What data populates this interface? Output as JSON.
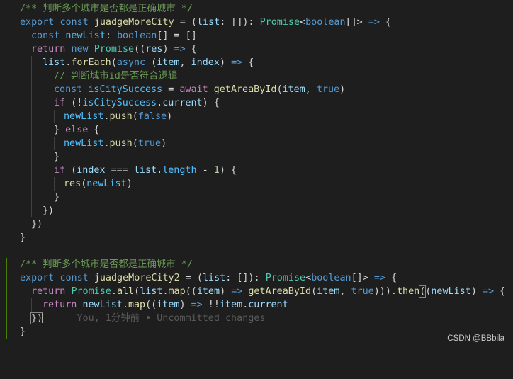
{
  "editor": {
    "block1": {
      "comment": "/** 判断多个城市是否都是正确城市 */",
      "kw_export": "export",
      "kw_const": "const",
      "fn_name": "juadgeMoreCity",
      "eq": " = (",
      "param": "list",
      "param_type": ": []): ",
      "ret_type": "Promise",
      "ret_generic_open": "<",
      "ret_generic_inner": "boolean",
      "ret_generic_close": "[]> ",
      "arrow": "=>",
      "brace_open": " {",
      "l2_const": "const",
      "l2_var": "newList",
      "l2_colon": ": ",
      "l2_type": "boolean",
      "l2_rest": "[] = []",
      "l3_return": "return",
      "l3_new": "new",
      "l3_promise": "Promise",
      "l3_open": "((",
      "l3_res": "res",
      "l3_close": ") ",
      "l3_arrow": "=>",
      "l3_brace": " {",
      "l4_list": "list",
      "l4_dot": ".",
      "l4_foreach": "forEach",
      "l4_open": "(",
      "l4_async": "async",
      "l4_paren": " (",
      "l4_item": "item",
      "l4_comma": ", ",
      "l4_index": "index",
      "l4_close": ") ",
      "l4_arrow": "=>",
      "l4_brace": " {",
      "l5_comment": "// 判断城市id是否符合逻辑",
      "l6_const": "const",
      "l6_var": "isCitySuccess",
      "l6_eq": " = ",
      "l6_await": "await",
      "l6_fn": "getAreaById",
      "l6_open": "(",
      "l6_item": "item",
      "l6_comma": ", ",
      "l6_true": "true",
      "l6_close": ")",
      "l7_if": "if",
      "l7_open": " (!",
      "l7_var": "isCitySuccess",
      "l7_dot": ".",
      "l7_prop": "current",
      "l7_close": ") {",
      "l8_var": "newList",
      "l8_dot": ".",
      "l8_fn": "push",
      "l8_open": "(",
      "l8_false": "false",
      "l8_close": ")",
      "l9_open": "} ",
      "l9_else": "else",
      "l9_close": " {",
      "l10_var": "newList",
      "l10_dot": ".",
      "l10_fn": "push",
      "l10_open": "(",
      "l10_true": "true",
      "l10_close": ")",
      "l11": "}",
      "l12_if": "if",
      "l12_open": " (",
      "l12_index": "index",
      "l12_op": " === ",
      "l12_list": "list",
      "l12_dot": ".",
      "l12_length": "length",
      "l12_minus": " - ",
      "l12_num": "1",
      "l12_close": ") {",
      "l13_fn": "res",
      "l13_open": "(",
      "l13_var": "newList",
      "l13_close": ")",
      "l14": "}",
      "l15": "})",
      "l16": "})",
      "l17": "}"
    },
    "block2": {
      "comment": "/** 判断多个城市是否都是正确城市 */",
      "kw_export": "export",
      "kw_const": "const",
      "fn_name": "juadgeMoreCity2",
      "eq": " = (",
      "param": "list",
      "param_type": ": []): ",
      "ret_type": "Promise",
      "ret_generic_open": "<",
      "ret_generic_inner": "boolean",
      "ret_generic_close": "[]> ",
      "arrow": "=>",
      "brace_open": " {",
      "l2_return": "return",
      "l2_promise": "Promise",
      "l2_dot1": ".",
      "l2_all": "all",
      "l2_open1": "(",
      "l2_list": "list",
      "l2_dot2": ".",
      "l2_map": "map",
      "l2_open2": "((",
      "l2_item": "item",
      "l2_close2": ") ",
      "l2_arrow": "=>",
      "l2_sp": " ",
      "l2_fn": "getAreaById",
      "l2_open3": "(",
      "l2_item2": "item",
      "l2_comma": ", ",
      "l2_true": "true",
      "l2_close3": "))).",
      "l2_then": "then",
      "l2_open4": "(",
      "l2_open5": "(",
      "l2_newlist": "newList",
      "l2_close5": ") ",
      "l2_arrow2": "=>",
      "l2_brace": " {",
      "l3_return": "return",
      "l3_var": "newList",
      "l3_dot": ".",
      "l3_map": "map",
      "l3_open": "((",
      "l3_item": "item",
      "l3_close": ") ",
      "l3_arrow": "=>",
      "l3_bang": " !!",
      "l3_item2": "item",
      "l3_dot2": ".",
      "l3_prop": "current",
      "l4_close": "})",
      "l4_blame": "You, 1分钟前 • Uncommitted changes",
      "l5": "}"
    }
  },
  "watermark": "CSDN @BBbila",
  "colors": {
    "background": "#1e1e1e",
    "keyword": "#569cd6",
    "control": "#c586c0",
    "function": "#dcdcaa",
    "variable": "#9cdcfe",
    "type": "#4ec9b0",
    "comment": "#6a9955",
    "git_added": "#487e02"
  }
}
